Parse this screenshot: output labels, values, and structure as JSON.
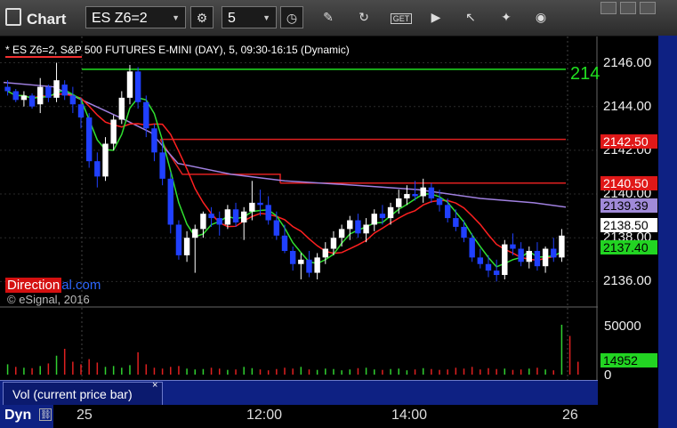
{
  "toolbar": {
    "title": "Chart",
    "symbol": "ES Z6=2",
    "interval": "5",
    "icons": [
      "clock-icon",
      "pencil-icon",
      "refresh-icon",
      "get-icon",
      "play-icon",
      "cursor-icon",
      "camera-icon",
      "window-icon"
    ]
  },
  "legend": "* ES Z6=2, S&P 500 FUTURES E-MINI (DAY), 5, 09:30-16:15 (Dynamic)",
  "price_axis": [
    "2146.00",
    "2144.00",
    "2142.00",
    "2140.00",
    "2138.00",
    "2136.00"
  ],
  "price_labels": {
    "red1": "2142.50",
    "red2": "2140.50",
    "purple": "2139.39",
    "white": "2138.50",
    "green": "2137.40",
    "top_green_text": "214"
  },
  "vol_axis": [
    "50000",
    "0"
  ],
  "vol_label": "14952",
  "watermark": {
    "red": "Direction",
    "blue": "al.com"
  },
  "copyright": "© eSignal, 2016",
  "study_tab": "Vol (current price bar)",
  "study_close": "×",
  "time_axis": {
    "dyn": "Dyn",
    "labels": [
      "25",
      "12:00",
      "14:00",
      "26"
    ]
  },
  "colors": {
    "up": "#ffffff",
    "down": "#2040ff",
    "ma_red": "#ff2020",
    "ma_green": "#30e030",
    "vwap": "#a080e0",
    "level_red": "#e02020",
    "level_green": "#20e020"
  },
  "chart_data": {
    "type": "candlestick",
    "ylim": [
      2135.0,
      2147.2
    ],
    "candles": [
      [
        2144.9,
        2145.2,
        2144.5,
        2144.7
      ],
      [
        2144.7,
        2144.8,
        2144.2,
        2144.3
      ],
      [
        2144.3,
        2144.7,
        2144.0,
        2144.5
      ],
      [
        2144.5,
        2144.6,
        2143.9,
        2144.0
      ],
      [
        2144.1,
        2145.3,
        2143.7,
        2144.9
      ],
      [
        2144.9,
        2145.0,
        2144.2,
        2144.4
      ],
      [
        2144.4,
        2146.0,
        2144.2,
        2145.2
      ],
      [
        2145.0,
        2145.2,
        2144.3,
        2144.5
      ],
      [
        2144.5,
        2144.9,
        2143.7,
        2144.1
      ],
      [
        2144.1,
        2144.4,
        2143.0,
        2143.5
      ],
      [
        2143.5,
        2143.7,
        2141.2,
        2141.5
      ],
      [
        2141.5,
        2141.9,
        2140.3,
        2140.8
      ],
      [
        2140.8,
        2142.6,
        2140.6,
        2142.3
      ],
      [
        2142.3,
        2143.6,
        2142.0,
        2143.4
      ],
      [
        2143.4,
        2144.7,
        2143.2,
        2144.4
      ],
      [
        2144.4,
        2145.9,
        2144.1,
        2145.6
      ],
      [
        2145.6,
        2145.8,
        2143.9,
        2144.2
      ],
      [
        2144.2,
        2144.5,
        2142.6,
        2143.0
      ],
      [
        2143.0,
        2143.2,
        2141.5,
        2141.9
      ],
      [
        2141.9,
        2142.5,
        2140.4,
        2140.7
      ],
      [
        2140.7,
        2141.0,
        2138.2,
        2138.6
      ],
      [
        2138.6,
        2138.8,
        2137.0,
        2137.2
      ],
      [
        2137.2,
        2138.3,
        2136.9,
        2138.0
      ],
      [
        2138.0,
        2138.6,
        2136.4,
        2138.4
      ],
      [
        2138.4,
        2139.2,
        2138.0,
        2139.1
      ],
      [
        2139.1,
        2139.4,
        2138.5,
        2138.9
      ],
      [
        2138.9,
        2139.2,
        2138.1,
        2138.6
      ],
      [
        2138.6,
        2139.5,
        2138.4,
        2139.3
      ],
      [
        2139.3,
        2139.6,
        2138.5,
        2138.7
      ],
      [
        2138.7,
        2139.4,
        2137.9,
        2139.2
      ],
      [
        2139.2,
        2140.6,
        2138.8,
        2139.6
      ],
      [
        2139.6,
        2140.2,
        2139.0,
        2139.5
      ],
      [
        2139.5,
        2139.9,
        2138.6,
        2138.8
      ],
      [
        2138.8,
        2139.2,
        2137.9,
        2138.1
      ],
      [
        2138.1,
        2138.6,
        2137.3,
        2137.4
      ],
      [
        2137.4,
        2137.6,
        2136.5,
        2136.8
      ],
      [
        2136.8,
        2137.3,
        2136.1,
        2137.0
      ],
      [
        2137.0,
        2137.4,
        2136.2,
        2136.4
      ],
      [
        2136.4,
        2137.3,
        2136.1,
        2137.1
      ],
      [
        2137.1,
        2137.8,
        2136.8,
        2137.5
      ],
      [
        2137.5,
        2138.3,
        2137.2,
        2138.0
      ],
      [
        2138.0,
        2138.6,
        2137.6,
        2138.4
      ],
      [
        2138.4,
        2139.0,
        2137.9,
        2138.8
      ],
      [
        2138.8,
        2139.1,
        2138.0,
        2138.2
      ],
      [
        2138.2,
        2138.9,
        2137.8,
        2138.6
      ],
      [
        2138.6,
        2139.3,
        2138.3,
        2139.1
      ],
      [
        2139.1,
        2139.5,
        2138.6,
        2138.9
      ],
      [
        2138.9,
        2139.6,
        2138.6,
        2139.4
      ],
      [
        2139.4,
        2140.2,
        2139.1,
        2139.8
      ],
      [
        2139.8,
        2140.4,
        2139.5,
        2140.0
      ],
      [
        2140.0,
        2140.6,
        2139.7,
        2139.9
      ],
      [
        2139.9,
        2140.7,
        2139.6,
        2140.3
      ],
      [
        2140.3,
        2140.5,
        2139.6,
        2139.8
      ],
      [
        2139.8,
        2140.2,
        2139.2,
        2139.5
      ],
      [
        2139.5,
        2139.8,
        2138.7,
        2138.9
      ],
      [
        2138.9,
        2139.3,
        2138.3,
        2138.5
      ],
      [
        2138.5,
        2138.8,
        2137.8,
        2138.0
      ],
      [
        2138.0,
        2138.2,
        2136.9,
        2137.1
      ],
      [
        2137.1,
        2137.5,
        2136.6,
        2136.8
      ],
      [
        2136.8,
        2137.2,
        2136.2,
        2136.5
      ],
      [
        2136.5,
        2137.0,
        2136.0,
        2136.3
      ],
      [
        2136.3,
        2137.9,
        2136.1,
        2137.7
      ],
      [
        2137.7,
        2138.2,
        2137.2,
        2137.5
      ],
      [
        2137.5,
        2137.8,
        2136.7,
        2136.9
      ],
      [
        2136.9,
        2137.6,
        2136.6,
        2137.4
      ],
      [
        2137.4,
        2137.8,
        2136.5,
        2136.7
      ],
      [
        2136.7,
        2137.6,
        2136.4,
        2137.5
      ],
      [
        2137.5,
        2138.0,
        2136.9,
        2137.1
      ],
      [
        2137.1,
        2138.4,
        2136.9,
        2138.1
      ]
    ],
    "levels": [
      2145.7,
      2142.5,
      2140.5
    ],
    "last_price": 2138.5,
    "volume_max": 60000,
    "volume": [
      12000,
      9000,
      8000,
      7500,
      10000,
      13000,
      22000,
      30000,
      15000,
      12000,
      18000,
      14000,
      9000,
      10000,
      8000,
      11000,
      26000,
      12000,
      8000,
      7000,
      9000,
      10000,
      7000,
      6000,
      6500,
      8000,
      7000,
      5500,
      6000,
      9000,
      7500,
      6000,
      5000,
      6500,
      8000,
      7000,
      9000,
      6000,
      5500,
      7000,
      6500,
      5000,
      6000,
      7500,
      8000,
      6000,
      5500,
      6500,
      7000,
      5000,
      6000,
      7500,
      6500,
      5500,
      6000,
      8000,
      7000,
      9000,
      6000,
      7500,
      6500,
      7000,
      5500,
      6000,
      7000,
      8000,
      6000,
      5000,
      58000,
      45000,
      14952
    ]
  }
}
